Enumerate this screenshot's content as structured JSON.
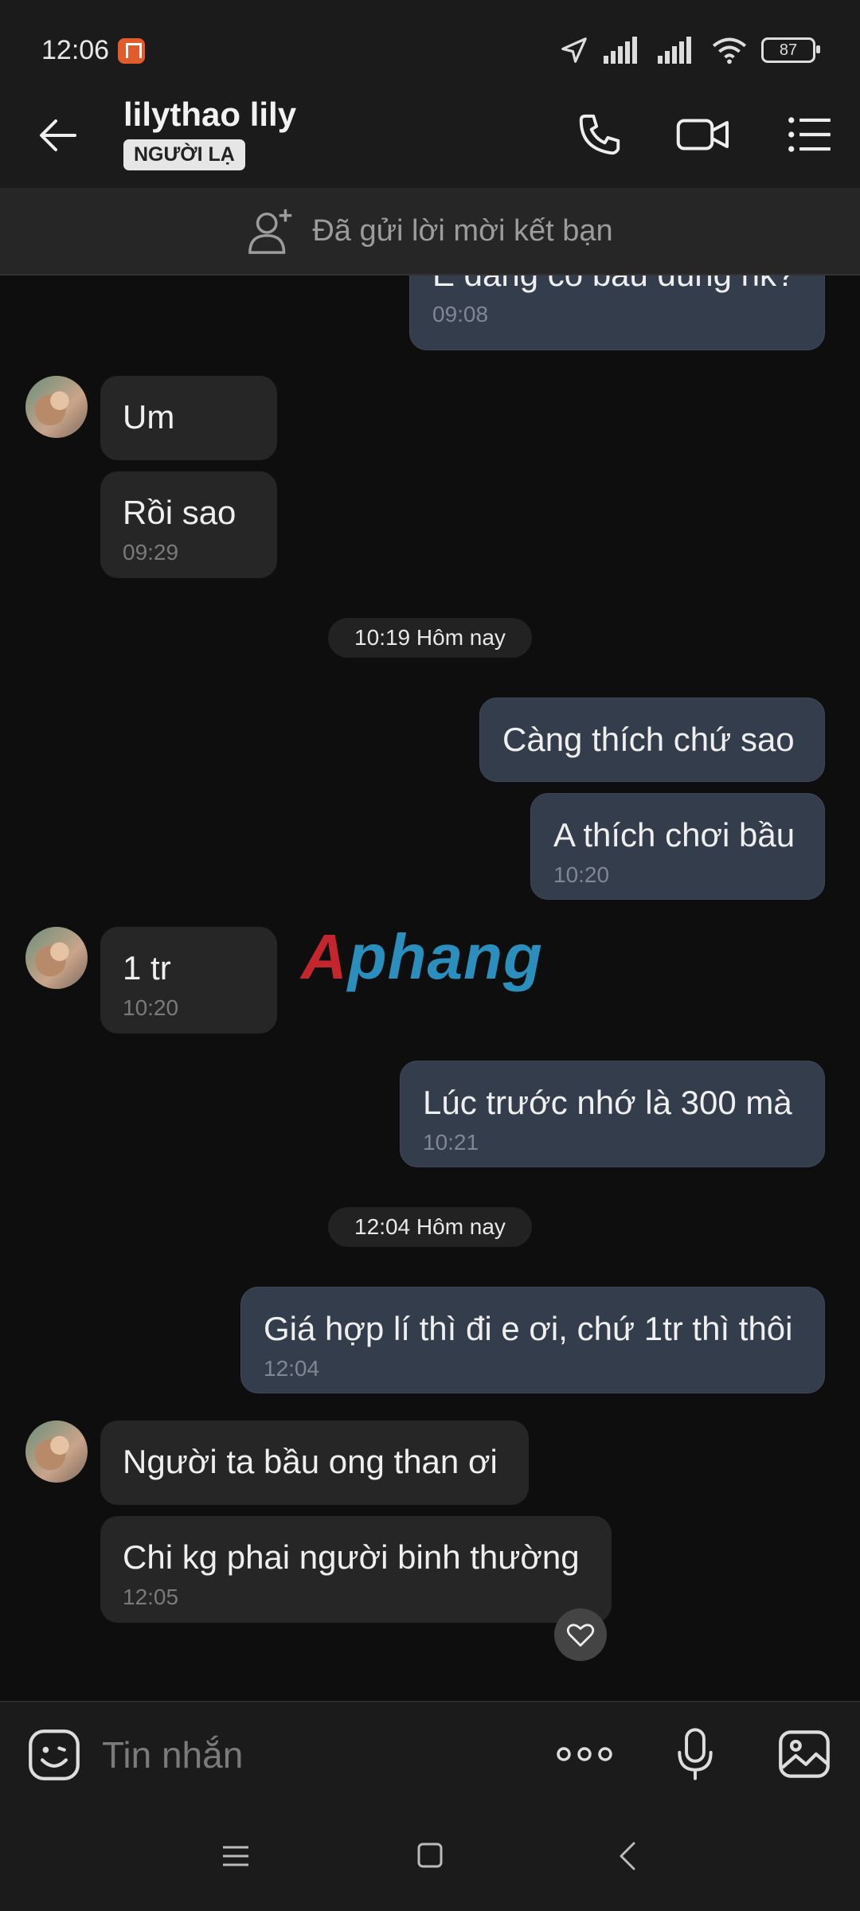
{
  "status": {
    "time": "12:06",
    "battery": "87"
  },
  "header": {
    "name": "lilythao lily",
    "badge": "NGƯỜI LẠ"
  },
  "friend_request": {
    "text": "Đã gửi lời mời kết bạn"
  },
  "messages": [
    {
      "text": "E đang có bầu đúng hk?",
      "time": "09:08"
    },
    {
      "text": "Um"
    },
    {
      "text": "Rồi sao",
      "time": "09:29"
    },
    {
      "separator": "10:19 Hôm nay"
    },
    {
      "text": "Càng thích chứ sao"
    },
    {
      "text": "A thích chơi bầu",
      "time": "10:20"
    },
    {
      "text": "1 tr",
      "time": "10:20"
    },
    {
      "text": "Lúc trước nhớ là 300 mà",
      "time": "10:21"
    },
    {
      "separator": "12:04 Hôm nay"
    },
    {
      "text": "Giá hợp lí thì đi e ơi, chứ 1tr thì thôi",
      "time": "12:04"
    },
    {
      "text": "Người ta bầu ong than ơi"
    },
    {
      "text": "Chi kg phai người binh thường",
      "time": "12:05"
    }
  ],
  "watermark": {
    "part1": "A",
    "part2": "phang"
  },
  "composer": {
    "placeholder": "Tin nhắn"
  },
  "colors": {
    "sent_bubble": "#343d4b",
    "recv_bubble": "#262626",
    "background": "#0e0e0e"
  }
}
